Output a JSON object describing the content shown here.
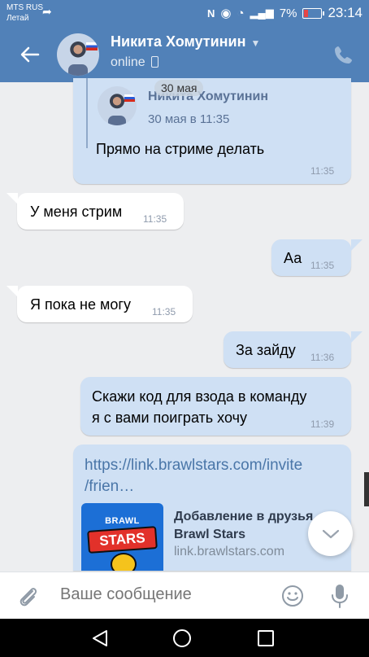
{
  "status_bar": {
    "carrier_line1": "MTS RUS",
    "carrier_line2": "Летай",
    "battery": "7%",
    "time": "23:14",
    "icons": [
      "back-arrow-icon",
      "nfc-icon",
      "eye-icon",
      "wifi-icon",
      "signal-icon",
      "battery-icon"
    ]
  },
  "header": {
    "contact_name": "Никита Хомутинин",
    "status": "online",
    "icons": [
      "back-arrow-icon",
      "chevron-down-icon",
      "mobile-phone-icon",
      "call-icon"
    ]
  },
  "forwarded_message": {
    "author": "Никита Хомутинин",
    "date_chip": "30 мая",
    "date": "30 мая в 11:35",
    "text": "Прямо на стриме делать",
    "time": "11:35"
  },
  "messages": [
    {
      "direction": "in",
      "text": "У меня стрим",
      "time": "11:35"
    },
    {
      "direction": "out",
      "text": "Аа",
      "time": "11:35"
    },
    {
      "direction": "in",
      "text": "Я пока не могу",
      "time": "11:35"
    },
    {
      "direction": "out",
      "text": "За зайду",
      "time": "11:36"
    },
    {
      "direction": "out",
      "text_line1": "Скажи код для взода в команду",
      "text_line2": "я с вами поиграть хочу",
      "time": "11:39"
    }
  ],
  "link_preview": {
    "url_line1": "https://link.brawlstars.com/invite",
    "url_line2": "/frien…",
    "logo_word1": "BRAWL",
    "logo_word2": "STARS",
    "title_line1": "Добавление в друзья",
    "title_line2": "Brawl Stars",
    "domain": "link.brawlstars.com"
  },
  "composer": {
    "placeholder": "Ваше сообщение",
    "icons": [
      "paperclip-icon",
      "smile-icon",
      "microphone-icon"
    ]
  },
  "colors": {
    "accent": "#5181b8",
    "outgoing_bubble": "#cfe0f4",
    "incoming_bubble": "#ffffff",
    "background": "#edeef0"
  }
}
